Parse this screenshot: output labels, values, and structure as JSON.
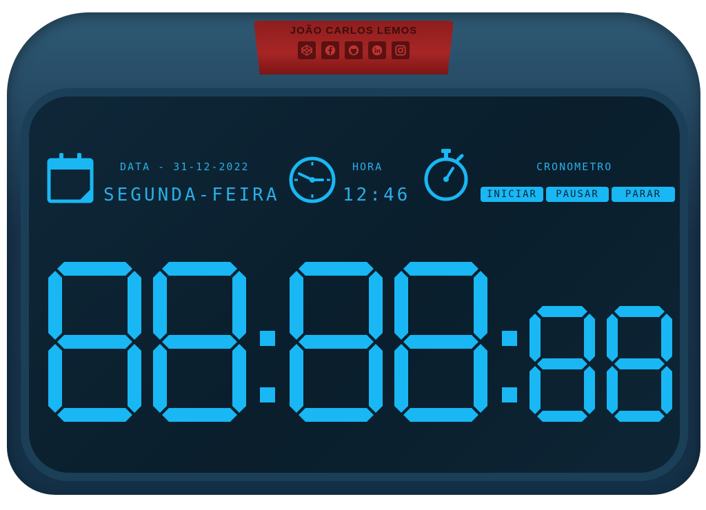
{
  "header": {
    "author": "JOÃO CARLOS LEMOS",
    "social_icons": [
      "codepen-icon",
      "facebook-icon",
      "github-icon",
      "linkedin-icon",
      "instagram-icon"
    ]
  },
  "date_panel": {
    "label": "DATA - 31-12-2022",
    "weekday": "SEGUNDA-FEIRA"
  },
  "time_panel": {
    "label": "HORA",
    "value": "12:46"
  },
  "stopwatch_panel": {
    "label": "CRONOMETRO",
    "buttons": [
      "INICIAR",
      "PAUSAR",
      "PARAR"
    ]
  },
  "display": {
    "hours": "88",
    "minutes": "88",
    "seconds": "88"
  },
  "colors": {
    "accent": "#19b7f4",
    "badge": "#a72525",
    "screen": "#0e2738"
  }
}
